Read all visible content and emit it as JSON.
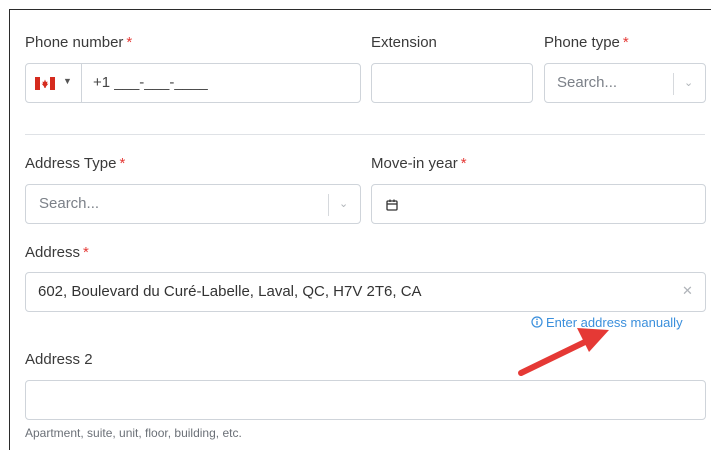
{
  "phone": {
    "label": "Phone number",
    "required_mark": "*",
    "value": "+1 ___-___-____",
    "country_flag": "canada-flag-icon"
  },
  "extension": {
    "label": "Extension",
    "value": ""
  },
  "phone_type": {
    "label": "Phone type",
    "required_mark": "*",
    "placeholder": "Search..."
  },
  "address_type": {
    "label": "Address Type",
    "required_mark": "*",
    "placeholder": "Search..."
  },
  "move_in_year": {
    "label": "Move-in year",
    "required_mark": "*",
    "value": ""
  },
  "address": {
    "label": "Address",
    "required_mark": "*",
    "value": "602, Boulevard du Curé-Labelle, Laval, QC, H7V 2T6, CA",
    "manual_link": "Enter address manually"
  },
  "address2": {
    "label": "Address 2",
    "value": "",
    "helper": "Apartment, suite, unit, floor, building, etc."
  },
  "colors": {
    "required": "#e53935",
    "link": "#3a8fdc",
    "arrow": "#e53935",
    "border": "#cfd4da",
    "flag_red": "#d52b1e"
  }
}
